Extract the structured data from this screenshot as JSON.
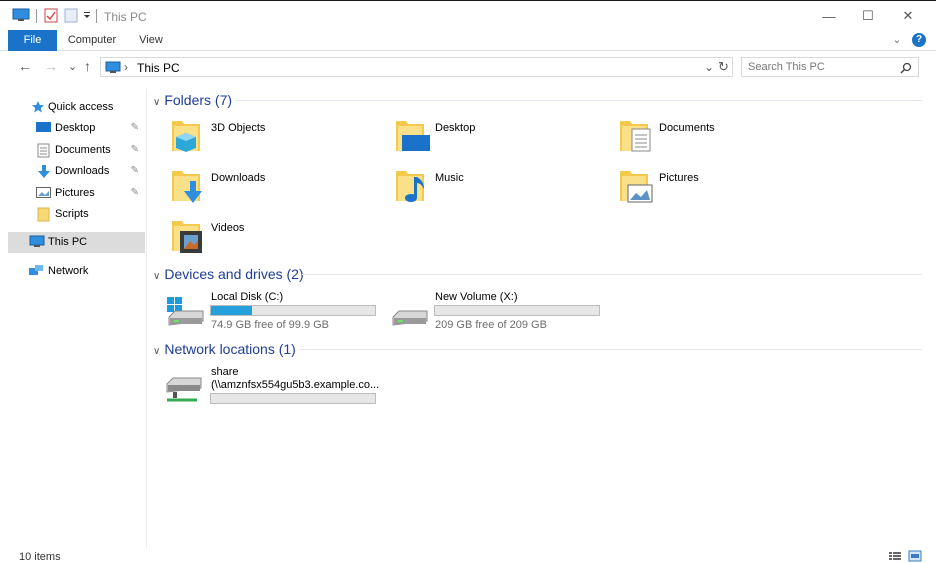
{
  "window": {
    "title": "This PC",
    "minimize": "—",
    "maximize": "☐",
    "close": "✕"
  },
  "ribbon": {
    "tabs": [
      "File",
      "Computer",
      "View"
    ],
    "expand": "⌄",
    "help": "?"
  },
  "address": {
    "back": "←",
    "forward": "→",
    "recent": "⌄",
    "up": "↑",
    "path": "This PC",
    "dropdown": "⌄",
    "refresh": "↻",
    "search_placeholder": "Search This PC"
  },
  "nav": {
    "quick_access": "Quick access",
    "items": [
      {
        "label": "Desktop",
        "pinned": true
      },
      {
        "label": "Documents",
        "pinned": true
      },
      {
        "label": "Downloads",
        "pinned": true
      },
      {
        "label": "Pictures",
        "pinned": true
      },
      {
        "label": "Scripts",
        "pinned": false
      }
    ],
    "this_pc": "This PC",
    "network": "Network"
  },
  "content": {
    "folders_header": "Folders (7)",
    "folders": [
      "3D Objects",
      "Desktop",
      "Documents",
      "Downloads",
      "Music",
      "Pictures",
      "Videos"
    ],
    "drives_header": "Devices and drives (2)",
    "drives": [
      {
        "name": "Local Disk (C:)",
        "free_text": "74.9 GB free of 99.9 GB",
        "used_fraction": 0.25
      },
      {
        "name": "New Volume (X:)",
        "free_text": "209 GB free of 209 GB",
        "used_fraction": 0.0
      }
    ],
    "network_header": "Network locations (1)",
    "network": [
      {
        "name": "share",
        "path": "(\\\\amznfsx554gu5b3.example.co...",
        "used_fraction": 0.0
      }
    ]
  },
  "status": {
    "items": "10 items"
  },
  "colors": {
    "accent": "#1a73c9",
    "section_header": "#1e3d96",
    "drive_bar": "#26a0da",
    "selection": "#dcdcdc"
  }
}
